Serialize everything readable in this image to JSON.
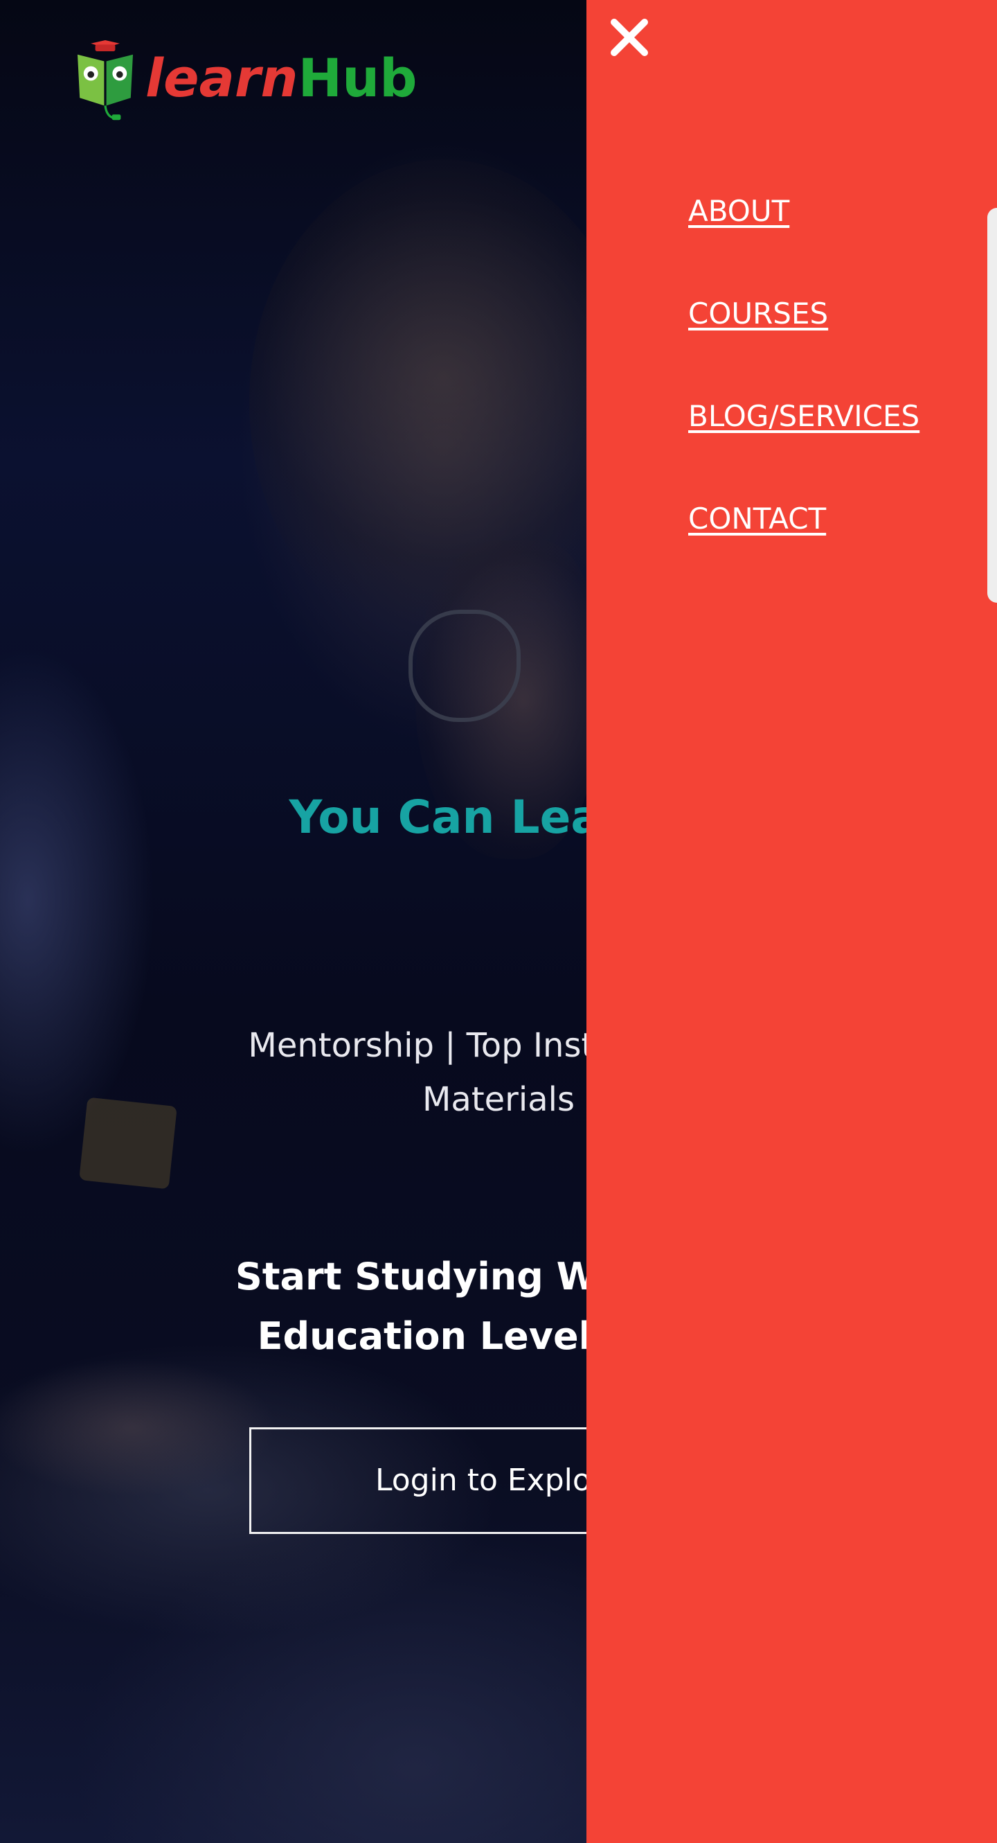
{
  "logo": {
    "word_learn": "learn",
    "word_hub": "Hub",
    "book_icon": "owl-book-graduation-cap-icon"
  },
  "hero": {
    "title": "You Can Learn A",
    "subtitle_line1": "Mentorship | Top Instrutors | C",
    "subtitle_line2": "Materials",
    "tagline_line1": "Start Studying With Us. I",
    "tagline_line2": "Education Level Up wit",
    "cta_label": "Login to Explore"
  },
  "drawer": {
    "close_icon": "close-icon",
    "nav": [
      {
        "label": "ABOUT"
      },
      {
        "label": "COURSES"
      },
      {
        "label": "BLOG/SERVICES"
      },
      {
        "label": "CONTACT"
      }
    ]
  },
  "colors": {
    "drawer_bg": "#f44336",
    "hero_title": "#17a3a3",
    "logo_learn": "#e53935",
    "logo_hub": "#1faa3a",
    "hero_bg": "#07091a"
  }
}
